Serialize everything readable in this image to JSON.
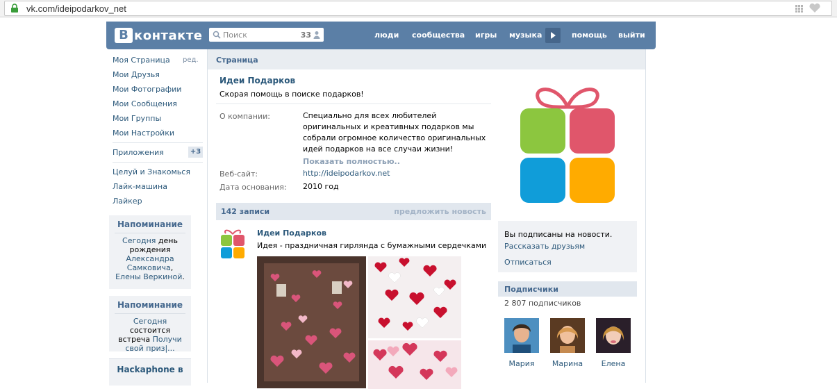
{
  "browser": {
    "url": "vk.com/ideipodarkov_net"
  },
  "header": {
    "logo_letter": "В",
    "logo_text": "контакте",
    "search_placeholder": "Поиск",
    "search_count": "33",
    "nav": [
      "люди",
      "сообщества",
      "игры",
      "музыка",
      "помощь",
      "выйти"
    ]
  },
  "left_menu": {
    "items": [
      "Моя Страница",
      "Мои Друзья",
      "Мои Фотографии",
      "Мои Сообщения",
      "Мои Группы",
      "Мои Настройки"
    ],
    "edit": "ред.",
    "apps": "Приложения",
    "apps_badge": "+3",
    "extra_items": [
      "Целуй и Знакомься",
      "Лайк-машина",
      "Лайкер"
    ]
  },
  "reminders": [
    {
      "title": "Напоминание",
      "parts": [
        "Сегодня",
        " день рождения ",
        "Александра Самковича",
        ", ",
        "Елены Веркиной",
        "."
      ]
    },
    {
      "title": "Напоминание",
      "parts": [
        "Сегодня",
        " состоится встреча ",
        "Получи свой приз|..."
      ]
    }
  ],
  "promo_title": "Hackaphone в",
  "page": {
    "section_title": "Страница",
    "name": "Идеи Подарков",
    "status": "Скорая помощь в поиске подарков!",
    "about_label": "О компании:",
    "about_text": "Специально для всех любителей оригинальных и креативных подарков мы собрали огромное количество оригинальных идей подарков на все случаи жизни!",
    "show_more": "Показать полностью..",
    "website_label": "Веб-сайт:",
    "website": "http://ideipodarkov.net",
    "founded_label": "Дата основания:",
    "founded": "2010 год"
  },
  "wall": {
    "count": "142 записи",
    "suggest": "предложить новость",
    "post_author": "Идеи Подарков",
    "post_text": "Идея - праздничная гирлянда с бумажными сердечками"
  },
  "subscription": {
    "status": "Вы подписаны на новости.",
    "tell_friends": "Рассказать друзьям",
    "unsubscribe": "Отписаться"
  },
  "followers": {
    "title": "Подписчики",
    "count": "2 807 подписчиков",
    "people": [
      "Мария",
      "Марина",
      "Елена"
    ]
  },
  "colors": {
    "vk_blue": "#5b7fa6",
    "link": "#2b587a",
    "gift_green": "#8cc63f",
    "gift_red": "#e0566b",
    "gift_blue": "#109dd9",
    "gift_orange": "#ffab00"
  }
}
